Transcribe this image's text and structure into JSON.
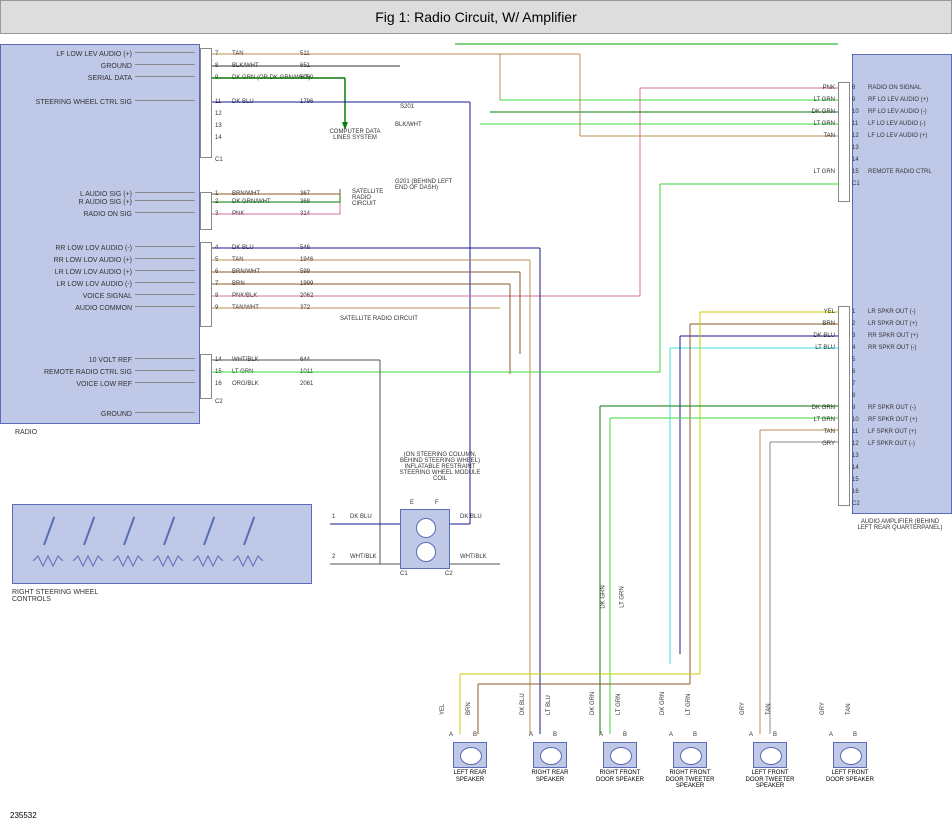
{
  "title": "Fig 1: Radio Circuit, W/ Amplifier",
  "footer_id": "235532",
  "radio_block_label": "RADIO",
  "radio_pins_left": [
    "LF LOW LEV AUDIO (+)",
    "GROUND",
    "SERIAL DATA",
    "STEERING WHEEL CTRL SIG",
    "L AUDIO SIG (+)",
    "R AUDIO SIG (+)",
    "RADIO ON SIG",
    "RR LOW LOV AUDIO (-)",
    "RR LOW LOV AUDIO (+)",
    "LR LOW LOV AUDIO (+)",
    "LR LOW LOV AUDIO (-)",
    "VOICE SIGNAL",
    "AUDIO COMMON",
    "10 VOLT REF",
    "REMOTE RADIO CTRL SIG",
    "VOICE LOW REF",
    "GROUND"
  ],
  "wire_labels": [
    {
      "pin": "7",
      "txt": "TAN",
      "num": "511"
    },
    {
      "pin": "8",
      "txt": "BLK/WHT",
      "num": "651"
    },
    {
      "pin": "9",
      "txt": "DK GRN (OR DK GRN/WHT)",
      "num": "5060"
    },
    {
      "pin": "11",
      "txt": "DK BLU",
      "num": "1796"
    },
    {
      "pin": "12",
      "txt": "",
      "num": ""
    },
    {
      "pin": "13",
      "txt": "",
      "num": ""
    },
    {
      "pin": "14",
      "txt": "",
      "num": ""
    },
    {
      "pin": "C1",
      "txt": "",
      "num": ""
    },
    {
      "pin": "1",
      "txt": "BRN/WHT",
      "num": "367"
    },
    {
      "pin": "2",
      "txt": "DK GRN/WHT",
      "num": "368"
    },
    {
      "pin": "3",
      "txt": "PNK",
      "num": "314"
    },
    {
      "pin": "4",
      "txt": "DK BLU",
      "num": "546"
    },
    {
      "pin": "5",
      "txt": "TAN",
      "num": "1946"
    },
    {
      "pin": "6",
      "txt": "BRN/WHT",
      "num": "599"
    },
    {
      "pin": "7",
      "txt": "BRN",
      "num": "1999"
    },
    {
      "pin": "8",
      "txt": "PNK/BLK",
      "num": "2062"
    },
    {
      "pin": "9",
      "txt": "TAN/WHT",
      "num": "372"
    },
    {
      "pin": "14",
      "txt": "WHT/BLK",
      "num": "644"
    },
    {
      "pin": "15",
      "txt": "LT GRN",
      "num": "1011"
    },
    {
      "pin": "16",
      "txt": "ORG/BLK",
      "num": "2061"
    },
    {
      "pin": "C2",
      "txt": "",
      "num": ""
    }
  ],
  "center_labels": {
    "computer": "COMPUTER DATA LINES SYSTEM",
    "s201": "S201",
    "blkwht": "BLK/WHT",
    "g201": "G201 (BEHIND LEFT END OF DASH)",
    "satellite": "SATELLITE RADIO CIRCUIT",
    "satellite2": "SATELLITE RADIO CIRCUIT"
  },
  "coil_label": "(ON STEERING COLUMN, BEHIND STEERING WHEEL) INFLATABLE RESTRAINT STEERING WHEEL MODULE COIL",
  "coil_wires": {
    "top_left": "DK BLU",
    "top_right": "DK BLU",
    "bot_left": "WHT/BLK",
    "bot_right": "WHT/BLK",
    "pin1": "1",
    "pin2": "2",
    "c1": "C1",
    "c2": "C2",
    "e": "E",
    "f": "F"
  },
  "switch_label": "RIGHT STEERING WHEEL CONTROLS",
  "amp_block_label": "AUDIO AMPLIFIER (BEHIND LEFT REAR QUARTERPANEL)",
  "amp_top": [
    {
      "pin": "8",
      "txt": "PNK",
      "lab": "RADIO ON SIGNAL"
    },
    {
      "pin": "9",
      "txt": "LT GRN",
      "lab": "RF LO LEV AUDIO (+)"
    },
    {
      "pin": "10",
      "txt": "DK GRN",
      "lab": "RF LO LEV AUDIO (-)"
    },
    {
      "pin": "11",
      "txt": "LT GRN",
      "lab": "LF LO LEV AUDIO (-)"
    },
    {
      "pin": "12",
      "txt": "TAN",
      "lab": "LF LO LEV AUDIO (+)"
    },
    {
      "pin": "13",
      "txt": "",
      "lab": ""
    },
    {
      "pin": "14",
      "txt": "",
      "lab": ""
    },
    {
      "pin": "15",
      "txt": "LT GRN",
      "lab": "REMOTE RADIO CTRL"
    },
    {
      "pin": "C1",
      "txt": "",
      "lab": ""
    }
  ],
  "amp_bot": [
    {
      "pin": "1",
      "txt": "YEL",
      "lab": "LR SPKR OUT (-)"
    },
    {
      "pin": "2",
      "txt": "BRN",
      "lab": "LR SPKR OUT (+)"
    },
    {
      "pin": "3",
      "txt": "DK BLU",
      "lab": "RR SPKR OUT (+)"
    },
    {
      "pin": "4",
      "txt": "LT BLU",
      "lab": "RR SPKR OUT (-)"
    },
    {
      "pin": "5",
      "txt": "",
      "lab": ""
    },
    {
      "pin": "6",
      "txt": "",
      "lab": ""
    },
    {
      "pin": "7",
      "txt": "",
      "lab": ""
    },
    {
      "pin": "8",
      "txt": "",
      "lab": ""
    },
    {
      "pin": "9",
      "txt": "DK GRN",
      "lab": "RF SPKR OUT (-)"
    },
    {
      "pin": "10",
      "txt": "LT GRN",
      "lab": "RF SPKR OUT (+)"
    },
    {
      "pin": "11",
      "txt": "TAN",
      "lab": "LF SPKR OUT (+)"
    },
    {
      "pin": "12",
      "txt": "GRY",
      "lab": "LF SPKR OUT (-)"
    },
    {
      "pin": "13",
      "txt": "",
      "lab": ""
    },
    {
      "pin": "14",
      "txt": "",
      "lab": ""
    },
    {
      "pin": "15",
      "txt": "",
      "lab": ""
    },
    {
      "pin": "16",
      "txt": "",
      "lab": ""
    },
    {
      "pin": "C2",
      "txt": "",
      "lab": ""
    }
  ],
  "speakers": [
    {
      "name": "LEFT REAR SPEAKER",
      "a": "YEL",
      "b": "BRN"
    },
    {
      "name": "RIGHT REAR SPEAKER",
      "a": "DK BLU",
      "b": "LT BLU"
    },
    {
      "name": "RIGHT FRONT DOOR SPEAKER",
      "a": "DK GRN",
      "b": "LT GRN"
    },
    {
      "name": "RIGHT FRONT DOOR TWEETER SPEAKER",
      "a": "DK GRN",
      "b": "LT GRN"
    },
    {
      "name": "LEFT FRONT DOOR TWEETER SPEAKER",
      "a": "GRY",
      "b": "TAN"
    },
    {
      "name": "LEFT FRONT DOOR SPEAKER",
      "a": "GRY",
      "b": "TAN"
    }
  ],
  "spk_wires_vert": [
    "DK GRN",
    "LT GRN"
  ],
  "ab_labels": {
    "a": "A",
    "b": "B"
  }
}
